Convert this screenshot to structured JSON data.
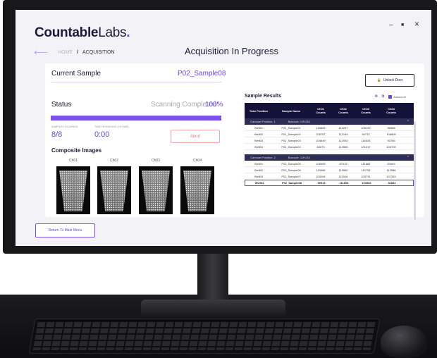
{
  "brand": {
    "bold": "Countable",
    "light": "Labs",
    "dot": "."
  },
  "window": {
    "minimize": "–",
    "maximize": "■",
    "close": "×"
  },
  "nav": {
    "back": "⟵",
    "home": "HOME",
    "sep": "/",
    "current": "ACQUISITION"
  },
  "page_title": "Acquisition In Progress",
  "current_sample": {
    "label": "Current Sample",
    "value": "P02_Sample08"
  },
  "status": {
    "label": "Status",
    "text": "Scanning Completed",
    "percent": "100%",
    "progress": 1.0
  },
  "samples_scanned": {
    "label": "SAMPLES SCANNED",
    "value": "8/8"
  },
  "time_remaining": {
    "label": "TIME REMAINING (HH:MM)",
    "value": "0:00"
  },
  "abort_label": "Abort",
  "composite": {
    "title": "Composite Images",
    "channels": [
      "Ch01",
      "Ch02",
      "Ch03",
      "Ch04"
    ]
  },
  "unlock_label": "Unlock Door",
  "results": {
    "title": "Sample Results",
    "autoscroll": "Autoscroll",
    "headers": [
      "Tube Position",
      "Sample Name",
      "Ch01\nCounts",
      "Ch02\nCounts",
      "Ch03\nCounts",
      "Ch04\nCounts"
    ],
    "groups": [
      {
        "carousel": "Carousel Position: 1",
        "barcode": "Barcode: 1JH13C",
        "rows": [
          [
            "Well01",
            "P01_Sample01",
            "119829",
            "111207",
            "105190",
            "96958"
          ],
          [
            "Well02",
            "P01_Sample02",
            "106767",
            "113149",
            "84732",
            "106809"
          ],
          [
            "Well03",
            "P01_Sample03",
            "104649",
            "111934",
            "116635",
            "93786"
          ],
          [
            "Well04",
            "P01_Sample04",
            "84573",
            "110565",
            "101317",
            "106709"
          ]
        ]
      },
      {
        "carousel": "Carousel Position: 2",
        "barcode": "Barcode: 1JH133",
        "rows": [
          [
            "Well01",
            "P02_Sample05",
            "108995",
            "87018",
            "111883",
            "87843"
          ],
          [
            "Well02",
            "P02_Sample06",
            "119068",
            "119582",
            "110753",
            "112586"
          ],
          [
            "Well03",
            "P02_Sample07",
            "109264",
            "110916",
            "109731",
            "107353"
          ],
          [
            "Well04",
            "P02_Sample08",
            "99913",
            "111608",
            "103082",
            "91681"
          ]
        ]
      }
    ]
  },
  "return_label": "Return To Main Menu"
}
